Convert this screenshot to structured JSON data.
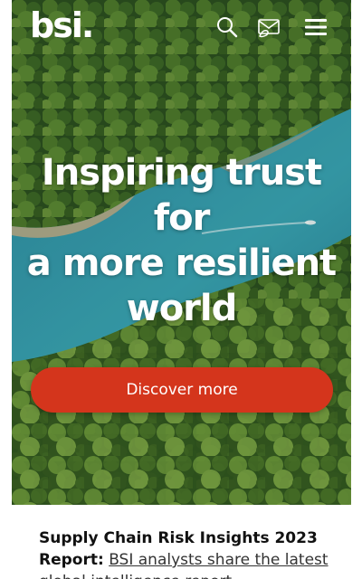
{
  "brand": {
    "logo_text": "bsi.",
    "accent_color": "#d4351c"
  },
  "header": {
    "icons": [
      "search-icon",
      "contact-icon",
      "menu-icon"
    ]
  },
  "hero": {
    "headline_lines": [
      "Inspiring trust",
      "for",
      "a more resilient",
      "world"
    ],
    "cta_label": "Discover more"
  },
  "news": {
    "title": "Supply Chain Risk Insights 2023",
    "title_cont": "Report:",
    "link_text": "BSI analysts share the latest global intelligence report"
  }
}
